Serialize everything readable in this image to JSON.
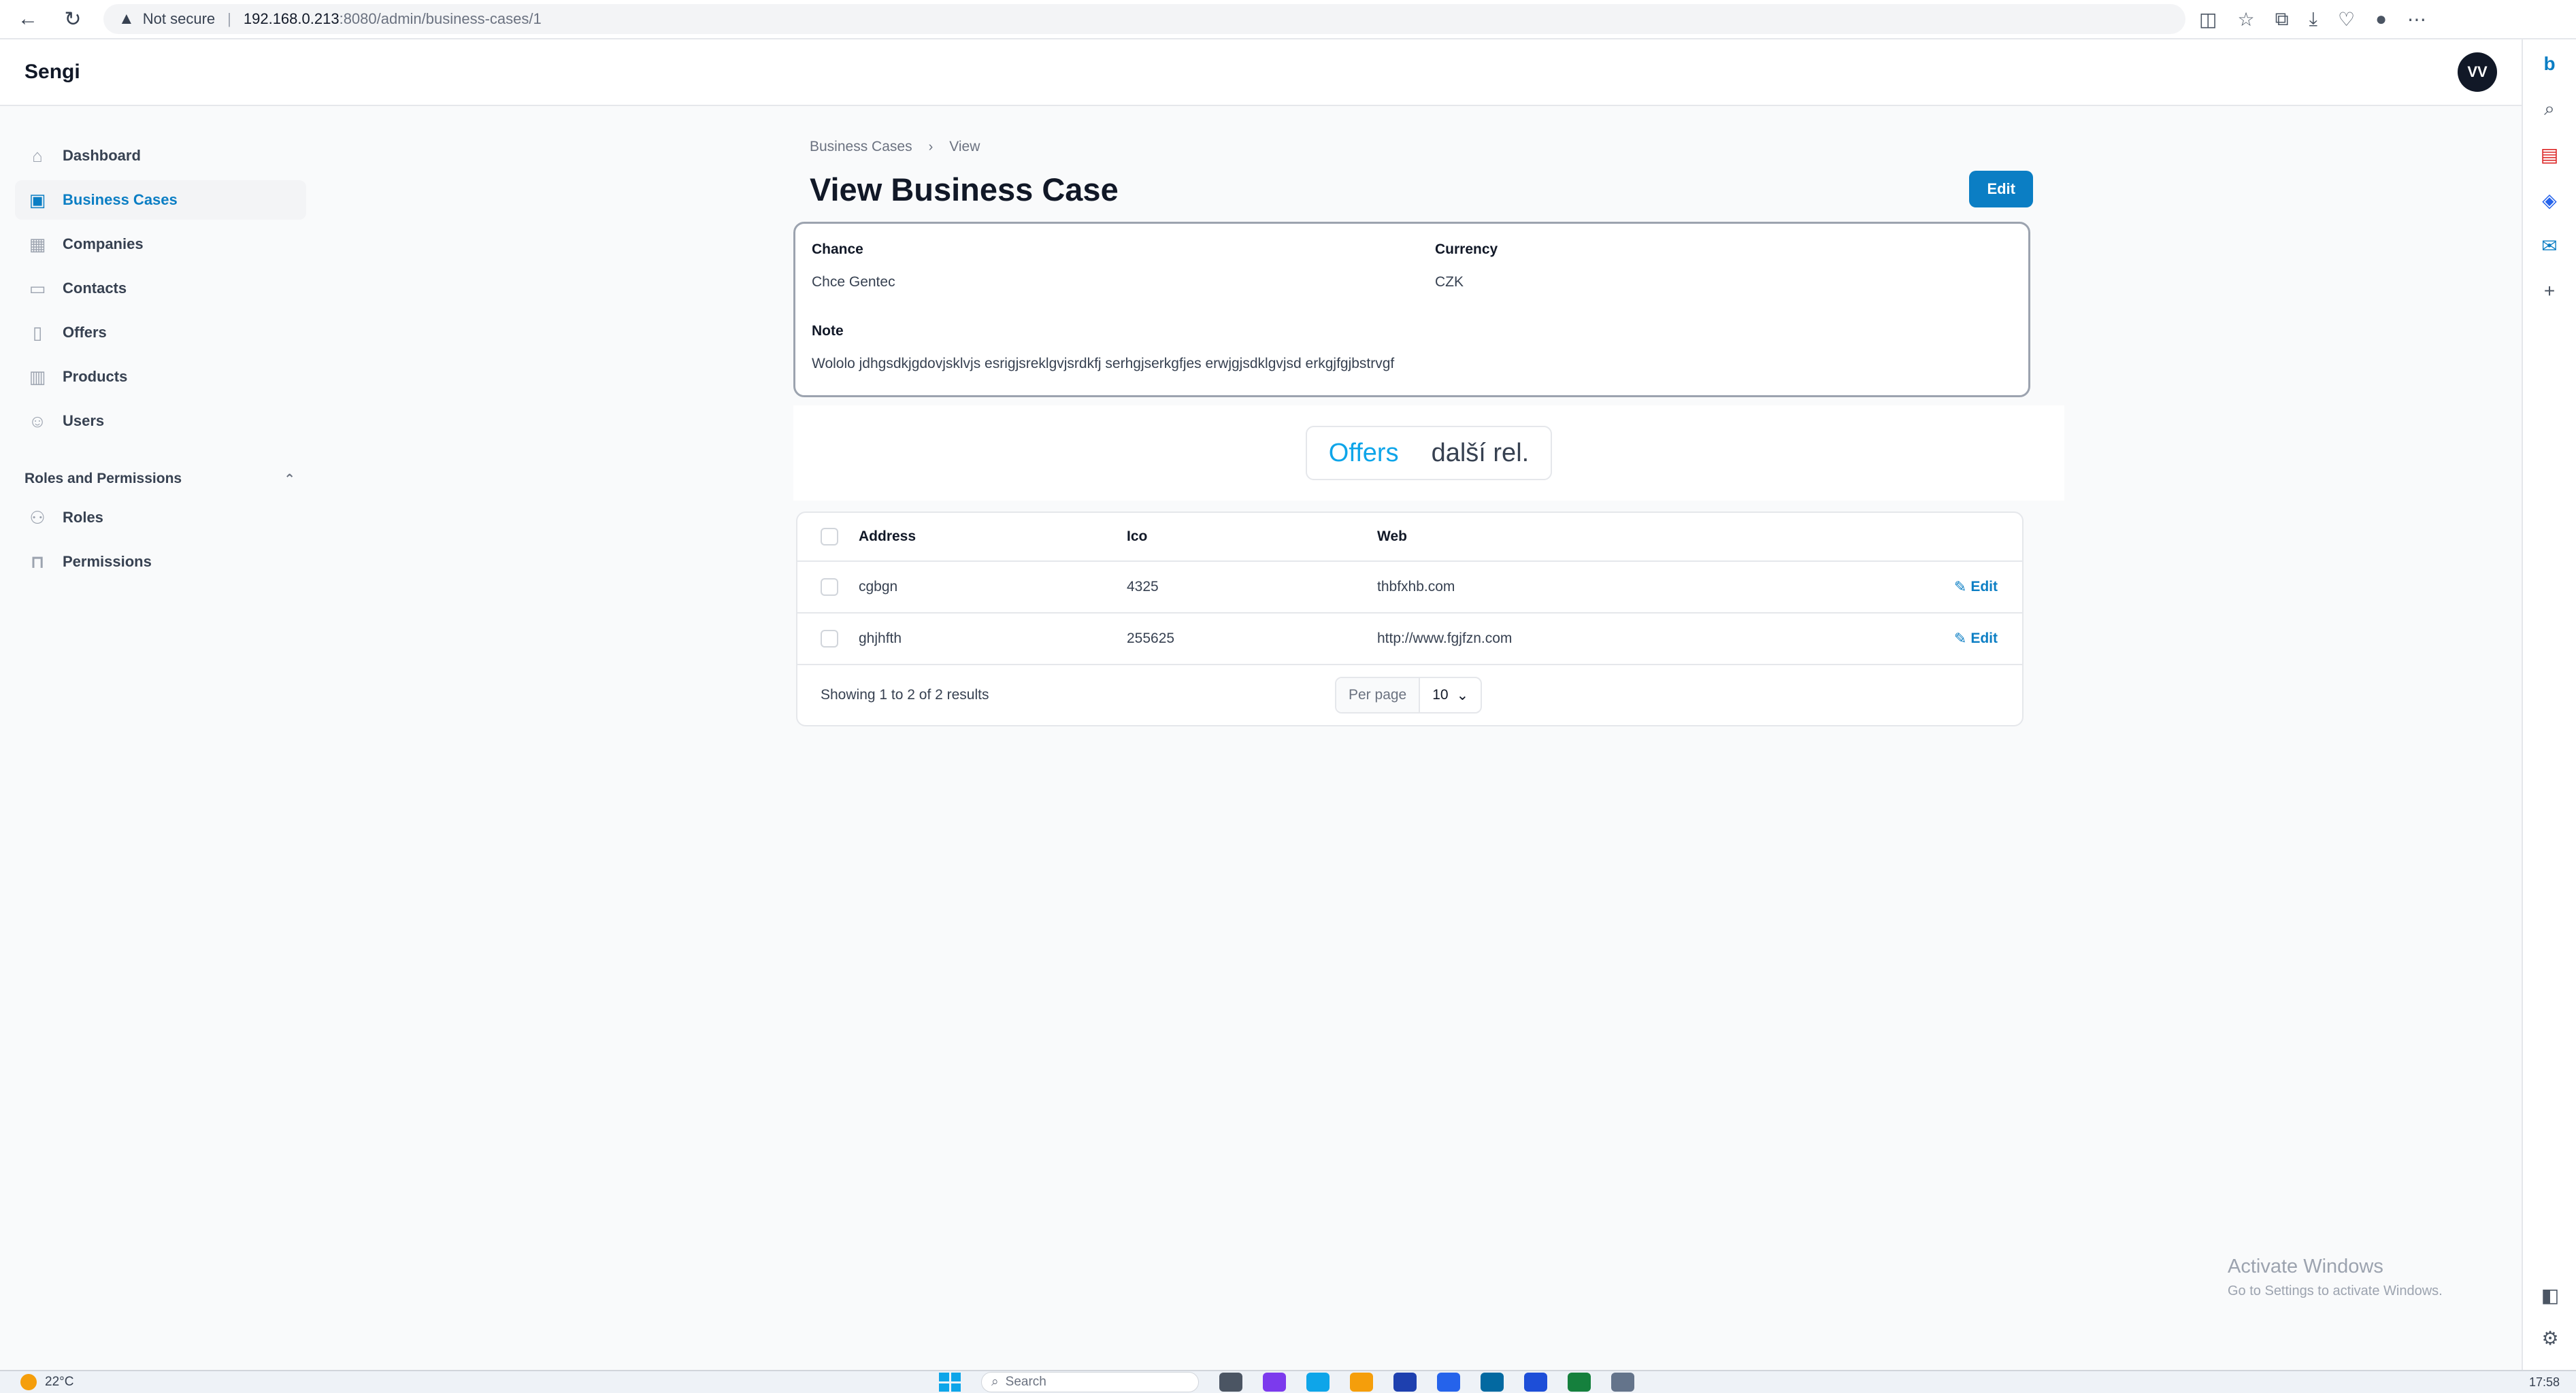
{
  "browser": {
    "security_label": "Not secure",
    "url_host": "192.168.0.213",
    "url_path": ":8080/admin/business-cases/1"
  },
  "app": {
    "brand": "Sengi",
    "avatar_initials": "VV"
  },
  "sidebar": {
    "items": [
      {
        "label": "Dashboard",
        "icon": "home-icon",
        "active": false
      },
      {
        "label": "Business Cases",
        "icon": "briefcase-icon",
        "active": true
      },
      {
        "label": "Companies",
        "icon": "building-icon",
        "active": false
      },
      {
        "label": "Contacts",
        "icon": "contact-card-icon",
        "active": false
      },
      {
        "label": "Offers",
        "icon": "document-icon",
        "active": false
      },
      {
        "label": "Products",
        "icon": "archive-icon",
        "active": false
      },
      {
        "label": "Users",
        "icon": "users-icon",
        "active": false
      }
    ],
    "group_label": "Roles and Permissions",
    "group_items": [
      {
        "label": "Roles",
        "icon": "user-group-icon"
      },
      {
        "label": "Permissions",
        "icon": "lock-icon"
      }
    ]
  },
  "breadcrumb": {
    "parent": "Business Cases",
    "current": "View"
  },
  "page": {
    "title": "View Business Case",
    "edit_label": "Edit"
  },
  "details": {
    "chance_label": "Chance",
    "chance_value": "Chce Gentec",
    "currency_label": "Currency",
    "currency_value": "CZK",
    "note_label": "Note",
    "note_value": "Wololo jdhgsdkjgdovjsklvjs esrigjsreklgvjsrdkfj serhgjserkgfjes erwjgjsdklgvjsd erkgjfgjbstrvgf"
  },
  "tabs": {
    "offers": "Offers",
    "other": "další rel."
  },
  "table": {
    "headers": {
      "address": "Address",
      "ico": "Ico",
      "web": "Web"
    },
    "rows": [
      {
        "address": "cgbgn",
        "ico": "4325",
        "web": "thbfxhb.com",
        "edit": "Edit"
      },
      {
        "address": "ghjhfth",
        "ico": "255625",
        "web": "http://www.fgjfzn.com",
        "edit": "Edit"
      }
    ],
    "summary": "Showing 1 to 2 of 2 results",
    "per_page_label": "Per page",
    "per_page_value": "10"
  },
  "watermark": {
    "title": "Activate Windows",
    "subtitle": "Go to Settings to activate Windows."
  },
  "taskbar": {
    "weather": "22°C",
    "search_placeholder": "Search",
    "clock": "17:58"
  },
  "colors": {
    "accent": "#0b7ec4",
    "tab_active": "#0ea5e9"
  }
}
